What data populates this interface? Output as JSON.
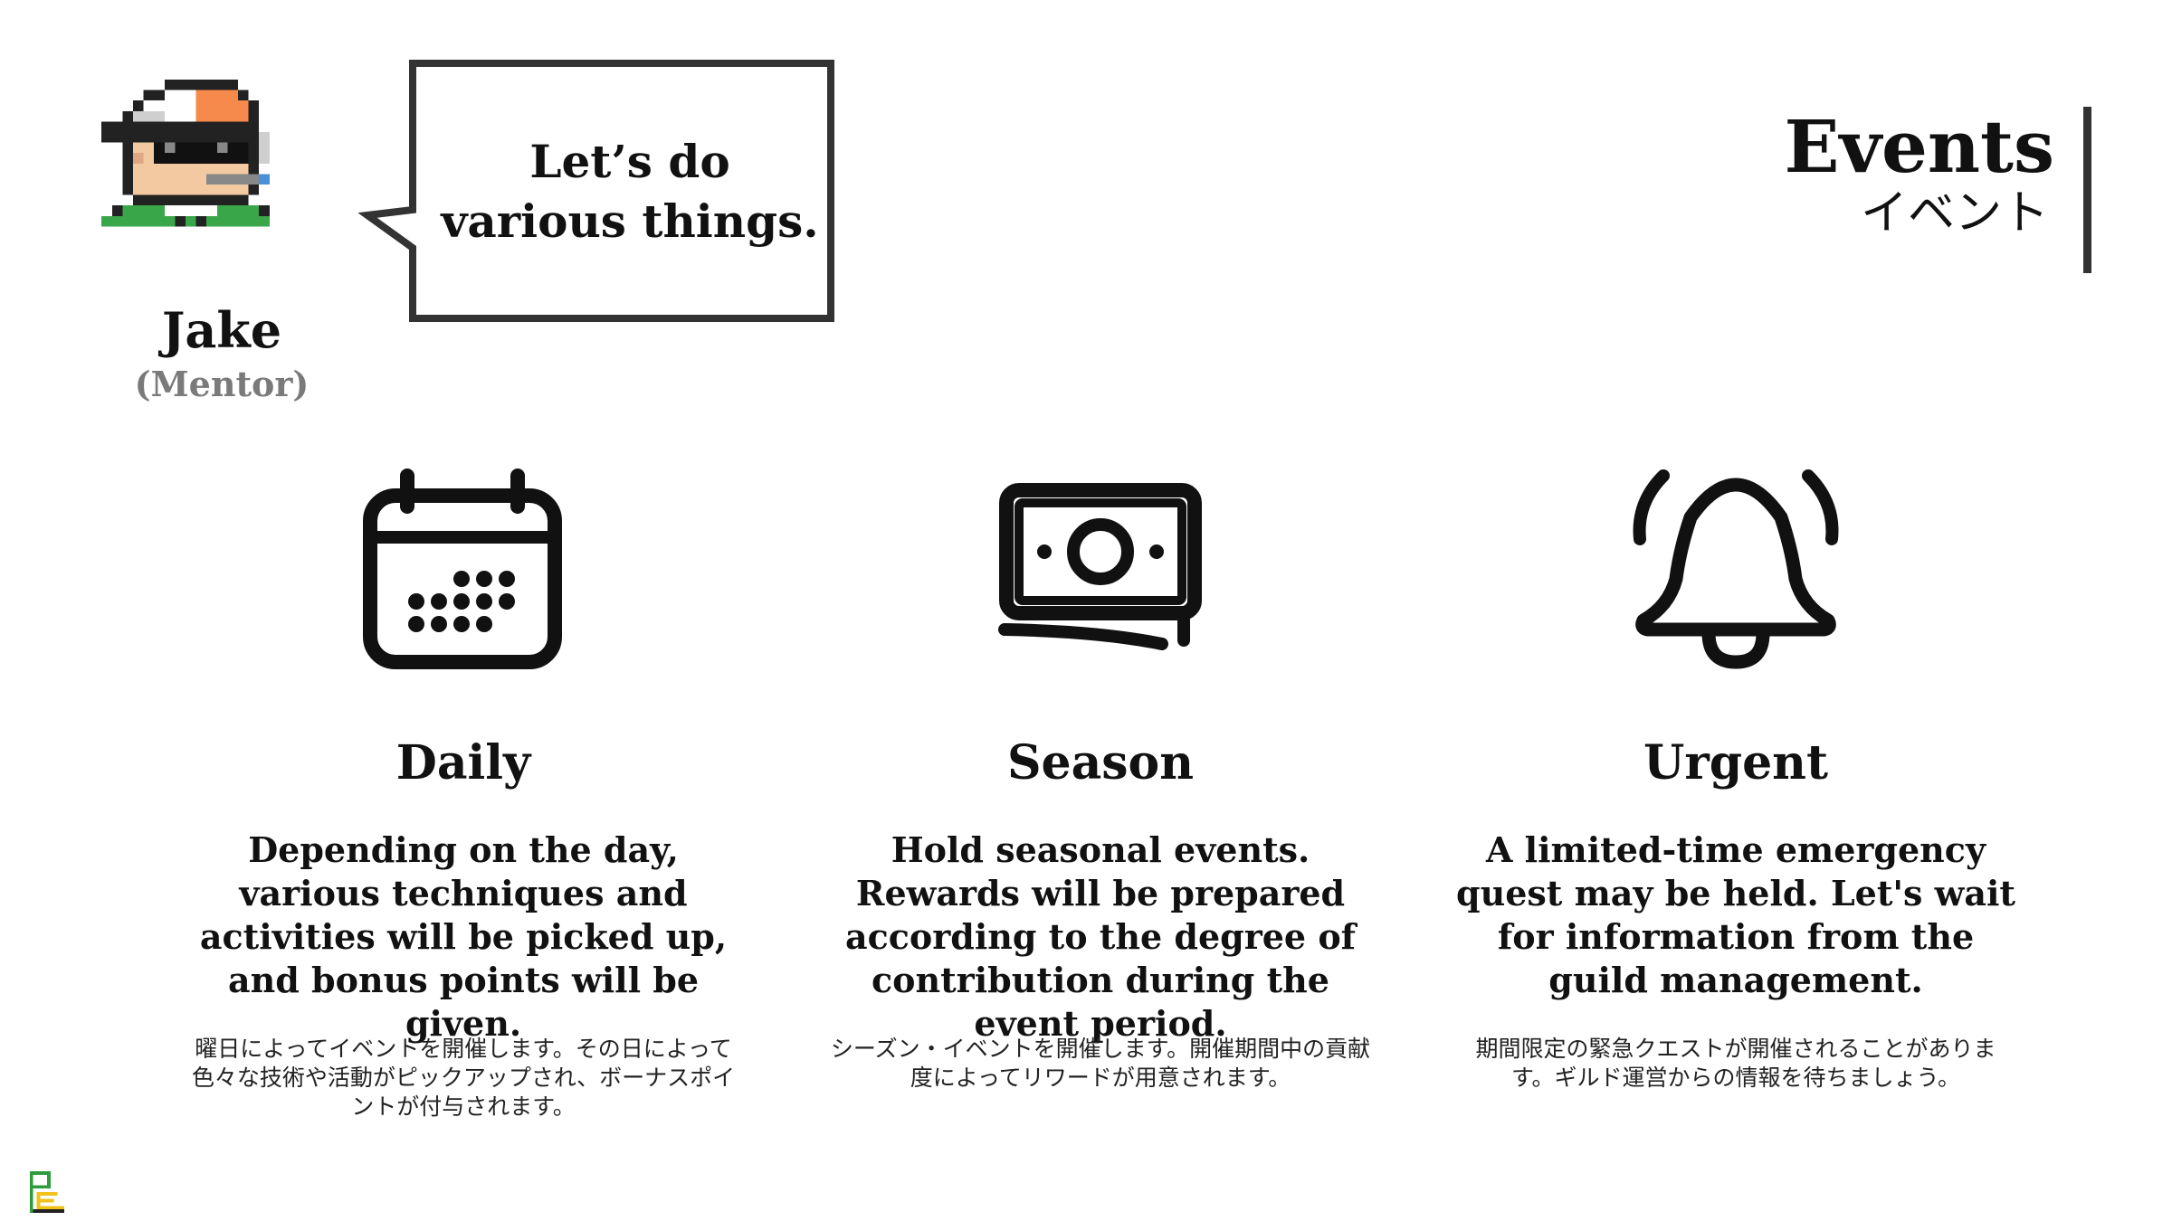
{
  "mentor": {
    "name": "Jake",
    "role": "(Mentor)"
  },
  "bubble": {
    "text": "Let’s do various things."
  },
  "header": {
    "title": "Events",
    "subtitle": "イベント"
  },
  "columns": [
    {
      "icon": "calendar-icon",
      "title": "Daily",
      "description": "Depending on the day, various techniques and activities will be picked up, and bonus points will be given.",
      "japanese": "曜日によってイベントを開催します。その日によって色々な技術や活動がピックアップされ、ボーナスポイントが付与されます。"
    },
    {
      "icon": "money-icon",
      "title": "Season",
      "description": "Hold seasonal events. Rewards will be prepared according to the degree of contribution during the event period.",
      "japanese": "シーズン・イベントを開催します。開催期間中の貢献度によってリワードが用意されます。"
    },
    {
      "icon": "bell-icon",
      "title": "Urgent",
      "description": "A limited-time emergency quest may be held. Let's wait for information from the guild management.",
      "japanese": "期間限定の緊急クエストが開催されることがあります。ギルド運営からの情報を待ちましょう。"
    }
  ],
  "colors": {
    "text": "#111111",
    "muted": "#7a7a7a",
    "cap": "#f58a4b",
    "shirt": "#3aa64a",
    "logo_green": "#2e9c3e",
    "logo_yellow": "#f2c21b"
  }
}
